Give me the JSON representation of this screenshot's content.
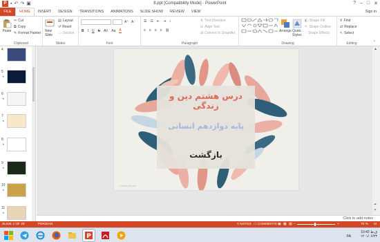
{
  "window": {
    "title": "8.ppt [Compatibility Mode] - PowerPoint",
    "app_logo": "P",
    "buttons": [
      "?",
      "–",
      "□",
      "✕"
    ]
  },
  "tabs": [
    "FILE",
    "HOME",
    "INSERT",
    "DESIGN",
    "TRANSITIONS",
    "ANIMATIONS",
    "SLIDE SHOW",
    "REVIEW",
    "VIEW"
  ],
  "active_tab": "HOME",
  "signin": "Sign in",
  "ribbon": {
    "clipboard": {
      "paste": "Paste",
      "cut": "Cut",
      "copy": "Copy",
      "format_painter": "Format Painter",
      "label": "Clipboard"
    },
    "slides": {
      "new_slide": "New Slide",
      "layout": "Layout",
      "reset": "Reset",
      "section": "Section",
      "label": "Slides"
    },
    "font": {
      "label": "Font"
    },
    "paragraph": {
      "text_direction": "Text Direction",
      "align_text": "Align Text",
      "convert_smartart": "Convert to SmartArt",
      "label": "Paragraph"
    },
    "drawing": {
      "arrange": "Arrange",
      "quick_styles": "Quick Styles",
      "shape_fill": "Shape Fill",
      "shape_outline": "Shape Outline",
      "shape_effects": "Shape Effects",
      "label": "Drawing"
    },
    "editing": {
      "find": "Find",
      "replace": "Replace",
      "select": "Select",
      "label": "Editing"
    }
  },
  "thumbnails": [
    {
      "num": "4",
      "bg": "#3a4a7a"
    },
    {
      "num": "5",
      "bg": "#0b1a3a"
    },
    {
      "num": "6",
      "bg": "#f4f4f4"
    },
    {
      "num": "7",
      "bg": "#f6e9c8"
    },
    {
      "num": "8",
      "bg": "#ffffff"
    },
    {
      "num": "9",
      "bg": "#1a2a1a"
    },
    {
      "num": "10",
      "bg": "#c9a24a"
    },
    {
      "num": "11",
      "bg": "#e9d6b8"
    }
  ],
  "slide": {
    "line1": "درس هشتم دین و زندگی",
    "line2": "پایه دوازدهم انسانی",
    "line3": "بازگشت",
    "credit": "Canva Studio"
  },
  "notes": {
    "placeholder": "Click to add notes"
  },
  "status": {
    "slide_of": "SLIDE 2 OF 29",
    "language": "PERSIAN",
    "notes": "NOTES",
    "comments": "COMMENTS",
    "zoom": "70 %"
  },
  "taskbar": {
    "time": "10:42 ق.ظ",
    "date": "۱۴۰۱/۰۶/۲۳",
    "lang": "FA"
  },
  "colors": {
    "accent": "#d24726",
    "taskbar": "#dde4ee"
  }
}
